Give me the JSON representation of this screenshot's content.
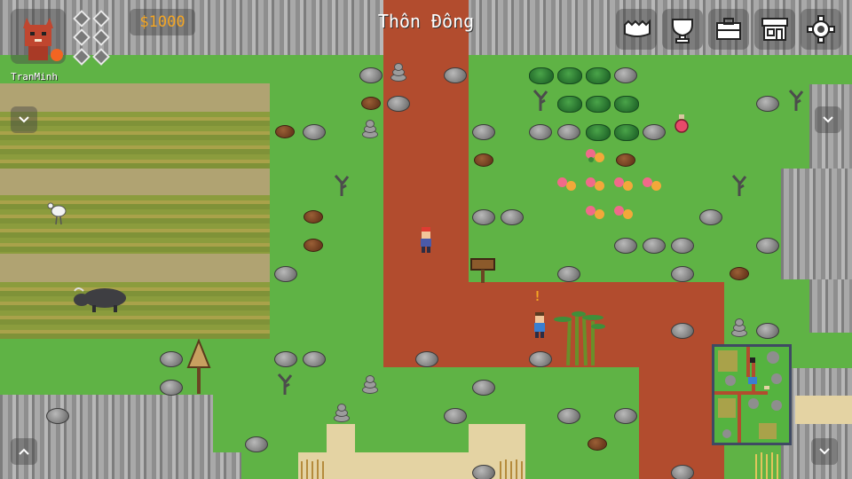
{
  "location_title": "Thôn Đông",
  "player": {
    "username": "TranMinh",
    "money": "$1000",
    "avatar_icon": "fox-demon-avatar-icon"
  },
  "toolbar": {
    "icons": [
      "friends-icon",
      "trophy-icon",
      "inventory-briefcase-icon",
      "shop-icon",
      "settings-gear-icon"
    ]
  },
  "npc_alert": "!",
  "colors": {
    "grass": "#5fb345",
    "path": "#b24c2e",
    "money": "#f5a623",
    "hud_bg": "rgba(70,70,70,0.45)",
    "minimap_border": "#3f4a63"
  }
}
